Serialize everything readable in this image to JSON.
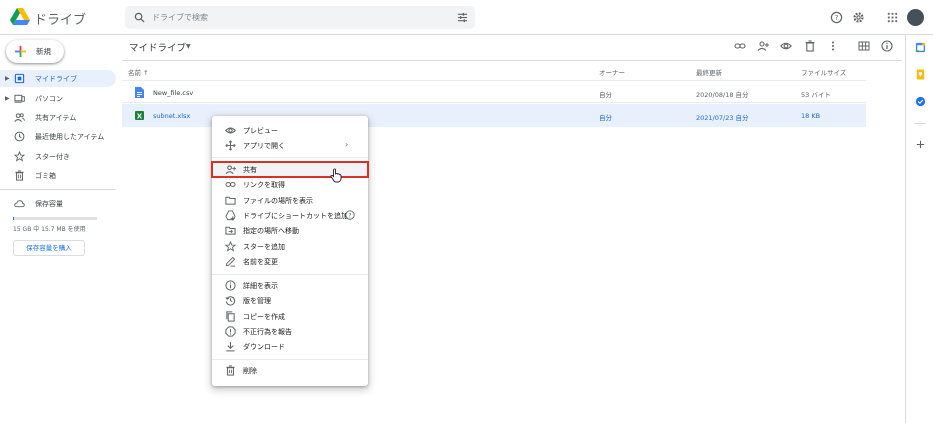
{
  "header": {
    "app_name": "ドライブ",
    "search_placeholder": "ドライブで検索"
  },
  "sidebar": {
    "new_label": "新規",
    "items": [
      {
        "label": "マイドライブ",
        "icon": "my-drive-icon",
        "active": true
      },
      {
        "label": "パソコン",
        "icon": "computer-icon"
      },
      {
        "label": "共有アイテム",
        "icon": "shared-icon"
      },
      {
        "label": "最近使用したアイテム",
        "icon": "clock-icon"
      },
      {
        "label": "スター付き",
        "icon": "star-icon"
      },
      {
        "label": "ゴミ箱",
        "icon": "trash-icon"
      }
    ],
    "storage_label": "保存容量",
    "storage_text": "15 GB 中 15.7 MB を使用",
    "storage_fraction": 0.001,
    "buy_storage": "保存容量を購入"
  },
  "main": {
    "breadcrumb": "マイドライブ",
    "columns": {
      "name": "名前 ↑",
      "owner": "オーナー",
      "modified": "最終更新",
      "size": "ファイルサイズ"
    },
    "files": [
      {
        "name": "New_file.csv",
        "owner": "自分",
        "modified": "2020/08/18 自分",
        "size": "53 バイト",
        "type": "doc",
        "selected": false
      },
      {
        "name": "subnet.xlsx",
        "owner": "自分",
        "modified": "2021/07/23 自分",
        "size": "18 KB",
        "type": "sheet",
        "selected": true
      }
    ]
  },
  "context_menu": {
    "items": [
      {
        "label": "プレビュー",
        "icon": "eye-icon"
      },
      {
        "label": "アプリで開く",
        "icon": "open-with-icon",
        "submenu": true
      },
      {
        "label": "共有",
        "icon": "person-add-icon",
        "highlight": true
      },
      {
        "label": "リンクを取得",
        "icon": "link-icon"
      },
      {
        "label": "ファイルの場所を表示",
        "icon": "folder-icon"
      },
      {
        "label": "ドライブにショートカットを追加",
        "icon": "shortcut-icon",
        "help": true
      },
      {
        "label": "指定の場所へ移動",
        "icon": "move-icon"
      },
      {
        "label": "スターを追加",
        "icon": "star-outline-icon"
      },
      {
        "label": "名前を変更",
        "icon": "pencil-icon"
      },
      {
        "label": "詳細を表示",
        "icon": "info-icon"
      },
      {
        "label": "版を管理",
        "icon": "history-icon"
      },
      {
        "label": "コピーを作成",
        "icon": "copy-icon"
      },
      {
        "label": "不正行為を報告",
        "icon": "report-icon"
      },
      {
        "label": "ダウンロード",
        "icon": "download-icon"
      },
      {
        "label": "削除",
        "icon": "delete-icon"
      }
    ]
  },
  "colors": {
    "accent": "#1a73e8",
    "selected_bg": "#e8f0fe",
    "highlight_border": "#d93025"
  }
}
